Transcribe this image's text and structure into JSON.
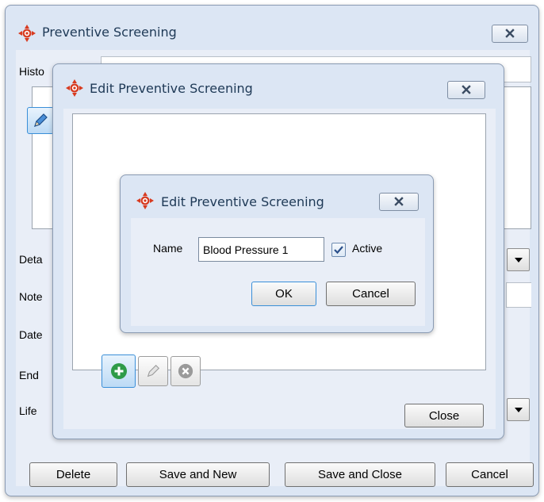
{
  "back_window": {
    "title": "Preventive Screening",
    "field_labels": {
      "history": "Histo",
      "details": "Deta",
      "notes": "Note",
      "date": "Date",
      "end": "End",
      "life": "Life"
    },
    "buttons": {
      "delete": "Delete",
      "save_and_new": "Save and New",
      "save_and_close": "Save and Close",
      "cancel": "Cancel"
    }
  },
  "middle_window": {
    "title": "Edit Preventive Screening",
    "close_label": "Close"
  },
  "front_dialog": {
    "title": "Edit Preventive Screening",
    "name_label": "Name",
    "name_value": "Blood Pressure 1",
    "active_label": "Active",
    "active_checked": true,
    "ok_label": "OK",
    "cancel_label": "Cancel"
  },
  "icons": [
    "app-logo-icon",
    "close-icon",
    "pencil-icon",
    "add-icon",
    "remove-icon",
    "chevron-down-icon"
  ],
  "colors": {
    "logo_red": "#d83a1f",
    "titlebar": "#dce6f4",
    "add_green": "#2e9b48",
    "focus_blue": "#3a8fd8"
  }
}
